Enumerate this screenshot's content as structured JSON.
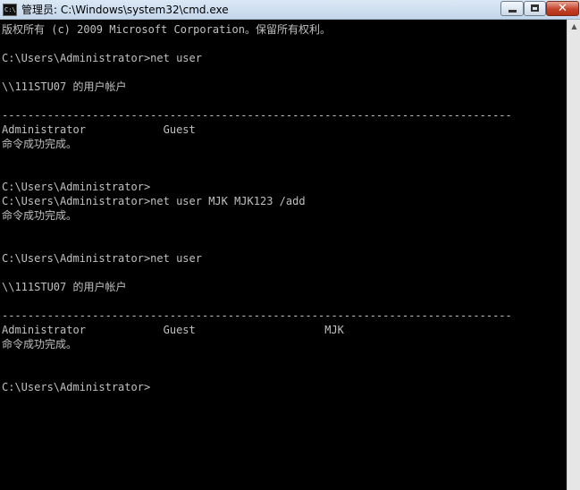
{
  "window": {
    "title": "管理员: C:\\Windows\\system32\\cmd.exe",
    "icon_text": "C:\\",
    "close_glyph": "✕"
  },
  "console": {
    "lines": [
      "版权所有 (c) 2009 Microsoft Corporation。保留所有权利。",
      "",
      "C:\\Users\\Administrator>net user",
      "",
      "\\\\111STU07 的用户帐户",
      "",
      "-------------------------------------------------------------------------------",
      "Administrator            Guest",
      "命令成功完成。",
      "",
      "",
      "C:\\Users\\Administrator>",
      "C:\\Users\\Administrator>net user MJK MJK123 /add",
      "命令成功完成。",
      "",
      "",
      "C:\\Users\\Administrator>net user",
      "",
      "\\\\111STU07 的用户帐户",
      "",
      "-------------------------------------------------------------------------------",
      "Administrator            Guest                    MJK",
      "命令成功完成。",
      "",
      "",
      "C:\\Users\\Administrator>"
    ]
  },
  "scrollbar": {
    "up_arrow": "▲"
  }
}
